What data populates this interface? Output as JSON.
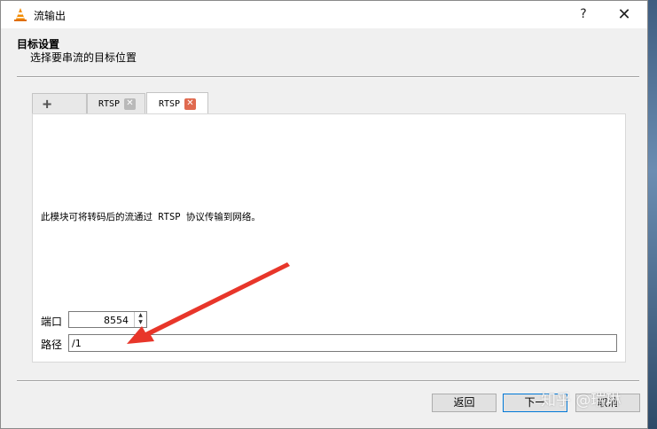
{
  "window": {
    "title": "流输出",
    "help_label": "?",
    "close_label": "✕"
  },
  "header": {
    "title": "目标设置",
    "subtitle": "选择要串流的目标位置"
  },
  "tabs": [
    {
      "label": "+",
      "icon": "plus-icon"
    },
    {
      "label": "RTSP",
      "closable": true,
      "close_style": "gray"
    },
    {
      "label": "RTSP",
      "closable": true,
      "close_style": "red",
      "active": true
    }
  ],
  "panel": {
    "description": "此模块可将转码后的流通过 RTSP 协议传输到网络。",
    "port_label": "端口",
    "port_value": "8554",
    "path_label": "路径",
    "path_value": "/1"
  },
  "buttons": {
    "back": "返回",
    "next": "下一",
    "cancel": "取消"
  },
  "watermark": "知乎 @瑞琳",
  "colors": {
    "arrow": "#e8362a",
    "tab_close_active": "#e06a4f",
    "primary_border": "#0078d7"
  }
}
